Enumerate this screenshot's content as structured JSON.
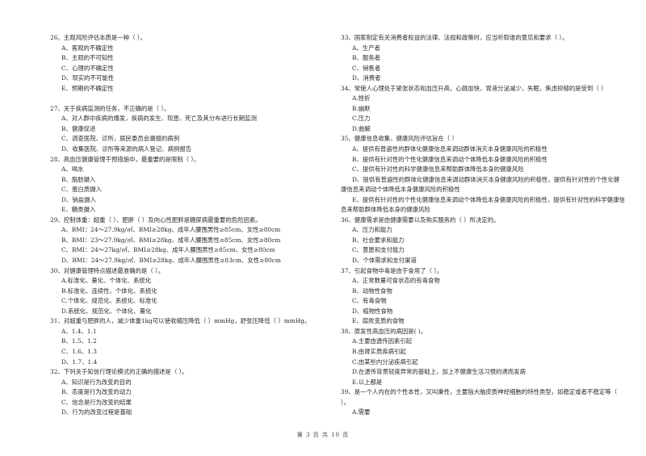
{
  "left_column": {
    "q26": {
      "stem": "26、主观风险评估本质是一种（      ）。",
      "options": [
        "A、客观的不确定性",
        "B、主观的不可知性",
        "C、心理的不确定性",
        "D、现实的不可能性",
        "E、预期的不确定性"
      ]
    },
    "q27": {
      "stem": "27、关于疾病监测的任务，不正确的是（      ）。",
      "options": [
        "A、对人群中疾病的爆发，疾病的发生、现患、死亡及其分布进行长期监测",
        "B、健康促进",
        "C、调查医院、诊所，居民委员会漏报的病例",
        "D、收集医院、诊所等来源的病人登记、病例报告"
      ]
    },
    "q28": {
      "stem": "28、高血压健康管理干预措施中，最重要的是限制（      ）。",
      "options": [
        "A、喝水",
        "B、脂肪摄入",
        "C、蛋白质摄入",
        "D、钠盐摄入",
        "E、糖类摄入"
      ]
    },
    "q29": {
      "stem": "29、控制体重：超重（      ）、肥胖（      ）及向心性肥胖是糖尿病最重要的危险因素。",
      "options": [
        "A、BMI：24～27.9kg/㎡、BMI≥28kg、成年人腰围男性≥85cm、女性≥80cm",
        "B、BMI：23～27.9kg/㎡、BMI≥28kg、成年人腰围男性≥85cm、女性≥80cm",
        "C、BMI：24～27kg/㎡、BMI≥28kg、成年人腰围男性≥85cm、女性≥80cm",
        "D、BMI：24～27.9kg/㎡、BMI≥28kg、成年人腰围男性≥83cm、女性≥80cm"
      ]
    },
    "q30": {
      "stem": "30、对健康管理特点描述最准确的是（      ）。",
      "options": [
        "A.标准化、量化、个体化、系统化",
        "B.标准化、连续性、个体化、系统化",
        "C.个体化、规范化、系统化、标准化",
        "D.系统化、规范化、个体化、量化"
      ]
    },
    "q31": {
      "stem": "31、对超重与肥胖的人，减少体重1kg可以使收缩压降低（      ）mmHg，舒张压降低（      ）mmHg。",
      "options": [
        "A、1.4、1.1",
        "B、1.5、1.2",
        "C、1.6、1.3",
        "D、1.7、1.4"
      ]
    },
    "q32": {
      "stem": "32、下列关于知信行理论模式的正确的描述是（      ）。",
      "options": [
        "A、知识是行为改变的目的",
        "B、态度是行为改变的动力",
        "C、信念是行为改变的结果",
        "D、行为的改变过程是基础"
      ]
    }
  },
  "right_column": {
    "q33": {
      "stem": "33、国家制定有关消费者权益的法律、法规和政策时，应当听取谁的意见和要求（      ）。",
      "options": [
        "A、生产者",
        "B、服务者",
        "C、销售者",
        "D、消费者"
      ]
    },
    "q34": {
      "stem": "34、常使人心理处于紧张状态和血压升高，心跳加快，胃液分泌减少，失眠，焦虑抑郁的是受到（      ）",
      "options": [
        "A.挫折",
        "B.幽默",
        "C.压力",
        "D.曲解"
      ]
    },
    "q35": {
      "stem": "35、健康信息收集，健康风险评估旨在（      ）",
      "options": [
        "A、提供有普遍性的群体化健康信息来调动群体消灭本身健康风险的积极性",
        "B、提供有针对性的个性化健康信息来调动个体降低本身健康风险的积极性",
        "C、提供有针对性的科学健康信息来帮助群体降低本身的健康风险",
        "D、提供有普遍性的群体化健康信息来调动群体消灭本身健康风险的积极性，提供有针对性的个性化健康信息来调动个体降低本身健康风险的积极性",
        "E、提供有针对性的个性化健康信息来调动个体降低本身健康风险的积极性，提供有针对性的科学健康信息来帮助群体降低本身的健康风险"
      ]
    },
    "q36": {
      "stem": "36、健康需求是由健康需要以及购买服务的（      ）所决定的。",
      "options": [
        "A、压力和能力",
        "B、社会要求和能力",
        "C、意愿和支付能力",
        "D、个体需求和支付渠道"
      ]
    },
    "q37": {
      "stem": "37、引起食物中毒是由于食用了（      ）。",
      "options": [
        "A、正常数量可食状态的有毒食物",
        "B、动物性食物",
        "C、有毒食物",
        "D、植物性食物",
        "E、腐败变质的食物"
      ]
    },
    "q38": {
      "stem": "38、原发性高血压的病因是(      )。",
      "options": [
        "A.主要由遗传因素引起",
        "B.由肾实质疾病引起",
        "C.由某些内分泌疾病引起",
        "D.在遗传背景轻度异常的基础上，加上不健康生活习惯的诱而发病",
        "E.以上都是"
      ]
    },
    "q39": {
      "stem": "39、是一个人内在的个性本性，又叫秉性，主要指大脑皮质神经细胞的特性类型，如稳定或者不稳定等（      ）。",
      "options": [
        "A.需要"
      ]
    }
  },
  "footer": {
    "page_indicator": "第 3 页 共 10 页"
  }
}
